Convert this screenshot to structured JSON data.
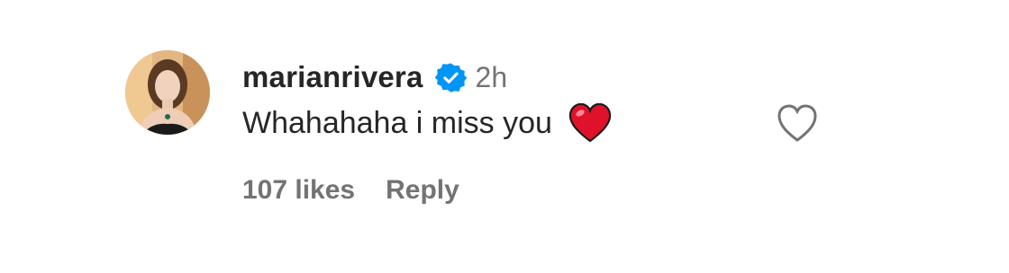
{
  "comment": {
    "username": "marianrivera",
    "verified_icon": "verified-badge-icon",
    "timestamp": "2h",
    "text": "Whahahaha i miss you",
    "emoji": "red-heart-emoji",
    "likes": "107 likes",
    "reply_label": "Reply",
    "like_icon": "heart-outline-icon"
  },
  "colors": {
    "text": "#262626",
    "secondary": "#737373",
    "verified": "#0095f6",
    "heart_emoji": "#e0112b"
  }
}
